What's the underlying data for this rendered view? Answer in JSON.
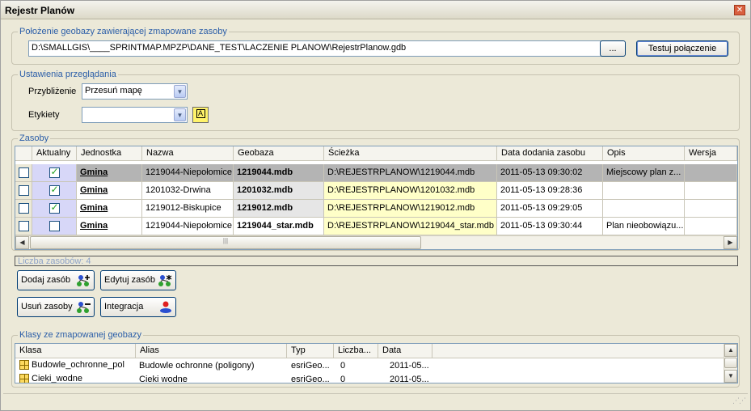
{
  "window": {
    "title": "Rejestr Planów",
    "close_label": "✕"
  },
  "location": {
    "legend": "Położenie geobazy zawierającej zmapowane zasoby",
    "path_value": "D:\\SMALLGIS\\____SPRINTMAP.MPZP\\DANE_TEST\\LACZENIE PLANOW\\RejestrPlanow.gdb",
    "browse_label": "...",
    "test_label": "Testuj połączenie"
  },
  "view_settings": {
    "legend": "Ustawienia przeglądania",
    "zoom_label": "Przybliżenie",
    "zoom_value": "Przesuń mapę",
    "labels_label": "Etykiety",
    "labels_value": "",
    "label_icon_glyph": "A"
  },
  "resources": {
    "legend": "Zasoby",
    "columns": [
      "",
      "Aktualny",
      "Jednostka",
      "Nazwa",
      "Geobaza",
      "Ścieżka",
      "Data dodania zasobu",
      "Opis",
      "Wersja"
    ],
    "rows": [
      {
        "selected": false,
        "current": true,
        "unit": "Gmina",
        "name": "1219044-Niepołomice",
        "geodb": "1219044.mdb",
        "path": "D:\\REJESTRPLANOW\\1219044.mdb",
        "date": "2011-05-13 09:30:02",
        "desc": "Miejscowy plan z...",
        "version": ""
      },
      {
        "selected": false,
        "current": true,
        "unit": "Gmina",
        "name": "1201032-Drwina",
        "geodb": "1201032.mdb",
        "path": "D:\\REJESTRPLANOW\\1201032.mdb",
        "date": "2011-05-13 09:28:36",
        "desc": "",
        "version": ""
      },
      {
        "selected": false,
        "current": true,
        "unit": "Gmina",
        "name": "1219012-Biskupice",
        "geodb": "1219012.mdb",
        "path": "D:\\REJESTRPLANOW\\1219012.mdb",
        "date": "2011-05-13 09:29:05",
        "desc": "",
        "version": ""
      },
      {
        "selected": false,
        "current": false,
        "unit": "Gmina",
        "name": "1219044-Niepołomice",
        "geodb": "1219044_star.mdb",
        "path": "D:\\REJESTRPLANOW\\1219044_star.mdb",
        "date": "2011-05-13 09:30:44",
        "desc": "Plan nieobowiązu...",
        "version": ""
      }
    ],
    "count_text": "Liczba zasobów: 4",
    "scroll_grip": "|||"
  },
  "actions": {
    "add_label": "Dodaj zasób",
    "edit_label": "Edytuj zasób",
    "remove_label": "Usuń zasoby",
    "integrate_label": "Integracja"
  },
  "classes": {
    "legend": "Klasy ze zmapowanej geobazy",
    "columns": [
      "Klasa",
      "Alias",
      "Typ",
      "Liczba...",
      "Data"
    ],
    "rows": [
      {
        "cls": "Budowle_ochronne_pol",
        "alias": "Budowle ochronne (poligony)",
        "type": "esriGeo...",
        "count": "0",
        "date": "2011-05..."
      },
      {
        "cls": "Cieki_wodne",
        "alias": "Cieki wodne",
        "type": "esriGeo...",
        "count": "0",
        "date": "2011-05..."
      }
    ]
  },
  "colors": {
    "accent": "#2b5ea8",
    "selected_row": "#b4b4b4",
    "path_highlight": "#ffffc8",
    "current_column": "#d7d7f8"
  },
  "grip_glyph": "⋰⋰"
}
